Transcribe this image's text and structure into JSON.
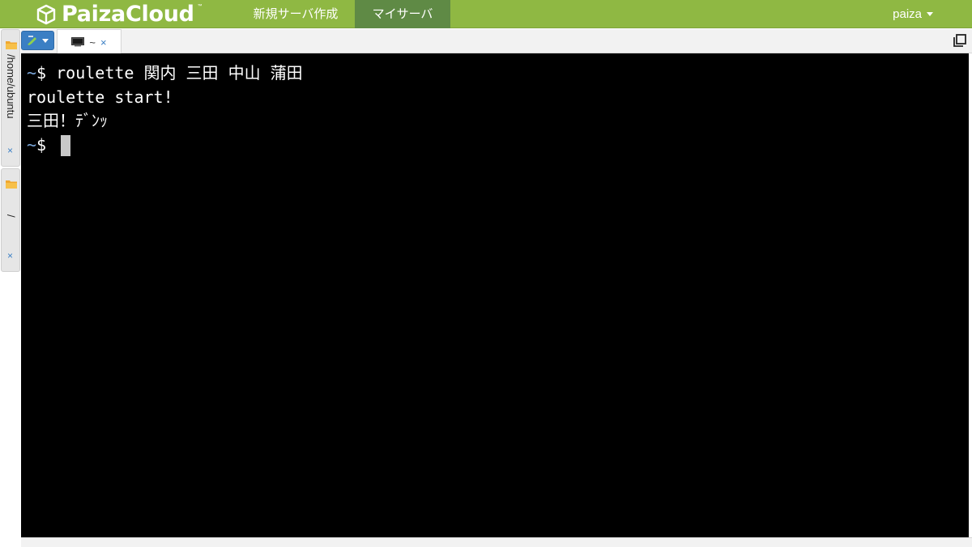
{
  "app": {
    "brand": "PaizaCloud",
    "trademark": "™"
  },
  "nav": {
    "new_server": "新規サーバ作成",
    "my_server": "マイサーバ",
    "user": "paiza"
  },
  "tabs": [
    {
      "label": "~",
      "close": "×"
    }
  ],
  "sidebar": {
    "items": [
      {
        "label": "/home/ubuntu",
        "close": "×"
      },
      {
        "label": "/",
        "close": "×"
      }
    ]
  },
  "terminal": {
    "lines": [
      {
        "prompt_tilde": "~",
        "prompt_symbol": "$ ",
        "text": "roulette 関内 三田 中山 蒲田"
      },
      {
        "text": "roulette start!"
      },
      {
        "text": "三田！ﾃﾞﾝｯ"
      },
      {
        "prompt_tilde": "~",
        "prompt_symbol": "$ "
      }
    ]
  },
  "colors": {
    "topbar": "#8fb843",
    "active_nav": "#5f8a45",
    "accent_blue": "#3b7fc4",
    "terminal_bg": "#000000",
    "prompt_tilde": "#7aa6da"
  }
}
